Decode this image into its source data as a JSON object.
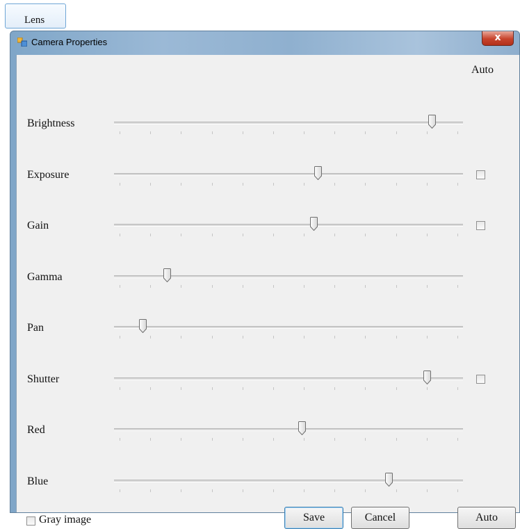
{
  "lens_button": {
    "label": "Lens"
  },
  "window": {
    "title": "Camera Properties",
    "close_label": "x",
    "auto_header": "Auto"
  },
  "sliders": [
    {
      "label": "Brightness",
      "value": 0.91,
      "ticks": 12,
      "auto_checkbox": false
    },
    {
      "label": "Exposure",
      "value": 0.584,
      "ticks": 12,
      "auto_checkbox": true,
      "auto_checked": false
    },
    {
      "label": "Gain",
      "value": 0.572,
      "ticks": 12,
      "auto_checkbox": true,
      "auto_checked": false
    },
    {
      "label": "Gamma",
      "value": 0.152,
      "ticks": 12,
      "auto_checkbox": false
    },
    {
      "label": "Pan",
      "value": 0.082,
      "ticks": 12,
      "auto_checkbox": false
    },
    {
      "label": "Shutter",
      "value": 0.897,
      "ticks": 12,
      "auto_checkbox": true,
      "auto_checked": false
    },
    {
      "label": "Red",
      "value": 0.538,
      "ticks": 12,
      "auto_checkbox": false
    },
    {
      "label": "Blue",
      "value": 0.787,
      "ticks": 12,
      "auto_checkbox": false
    }
  ],
  "footer": {
    "gray_image_label": "Gray image",
    "gray_image_checked": false,
    "save_label": "Save",
    "cancel_label": "Cancel",
    "auto_label": "Auto"
  },
  "icons": {
    "window_icon": "window-app-icon",
    "close": "close-icon"
  }
}
